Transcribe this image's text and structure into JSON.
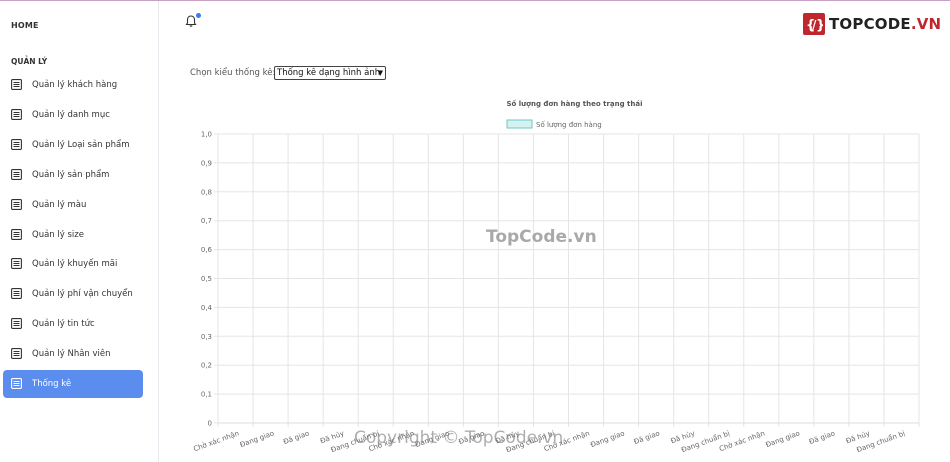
{
  "sidebar": {
    "home": "HOME",
    "section": "QUẢN LÝ",
    "items": [
      {
        "label": "Quản lý khách hàng",
        "active": false
      },
      {
        "label": "Quản lý danh mục",
        "active": false
      },
      {
        "label": "Quản lý Loại sản phẩm",
        "active": false
      },
      {
        "label": "Quản lý sản phẩm",
        "active": false
      },
      {
        "label": "Quản lý màu",
        "active": false
      },
      {
        "label": "Quản lý size",
        "active": false
      },
      {
        "label": "Quản lý khuyến mãi",
        "active": false
      },
      {
        "label": "Quản lý phí vận chuyển",
        "active": false
      },
      {
        "label": "Quản lý tin tức",
        "active": false
      },
      {
        "label": "Quản lý Nhân viên",
        "active": false
      },
      {
        "label": "Thống kê",
        "active": true
      }
    ]
  },
  "header": {
    "logo_main": "TOPCODE",
    "logo_tld": ".VN"
  },
  "controls": {
    "label": "Chọn kiểu thống kê:",
    "select_value": "Thống kê dạng hình ảnh"
  },
  "colors": {
    "accent": "#5b8def",
    "legend_fill": "#d4f2f2",
    "legend_border": "#6cc8c8"
  },
  "chart_data": {
    "type": "bar",
    "title": "Số lượng đơn hàng theo trạng thái",
    "legend": [
      "Số lượng đơn hàng"
    ],
    "ylim": [
      0,
      1
    ],
    "yticks": [
      "0",
      "0,1",
      "0,2",
      "0,3",
      "0,4",
      "0,5",
      "0,6",
      "0,7",
      "0,8",
      "0,9",
      "1,0"
    ],
    "categories": [
      "Chờ xác nhận",
      "Đang giao",
      "Đã giao",
      "Đã hủy",
      "Đang chuẩn bị",
      "Chờ xác nhận",
      "Đang giao",
      "Đã giao",
      "Đã hủy",
      "Đang chuẩn bị",
      "Chờ xác nhận",
      "Đang giao",
      "Đã giao",
      "Đã hủy",
      "Đang chuẩn bị",
      "Chờ xác nhận",
      "Đang giao",
      "Đã giao",
      "Đã hủy",
      "Đang chuẩn bị"
    ],
    "series": [
      {
        "name": "Số lượng đơn hàng",
        "values": [
          0,
          0,
          0,
          0,
          0,
          0,
          0,
          0,
          0,
          0,
          0,
          0,
          0,
          0,
          0,
          0,
          0,
          0,
          0,
          0
        ]
      }
    ],
    "grid": true,
    "legend_position": "top"
  },
  "watermarks": [
    "TopCode.vn",
    "Copyright © TopCode.vn"
  ]
}
